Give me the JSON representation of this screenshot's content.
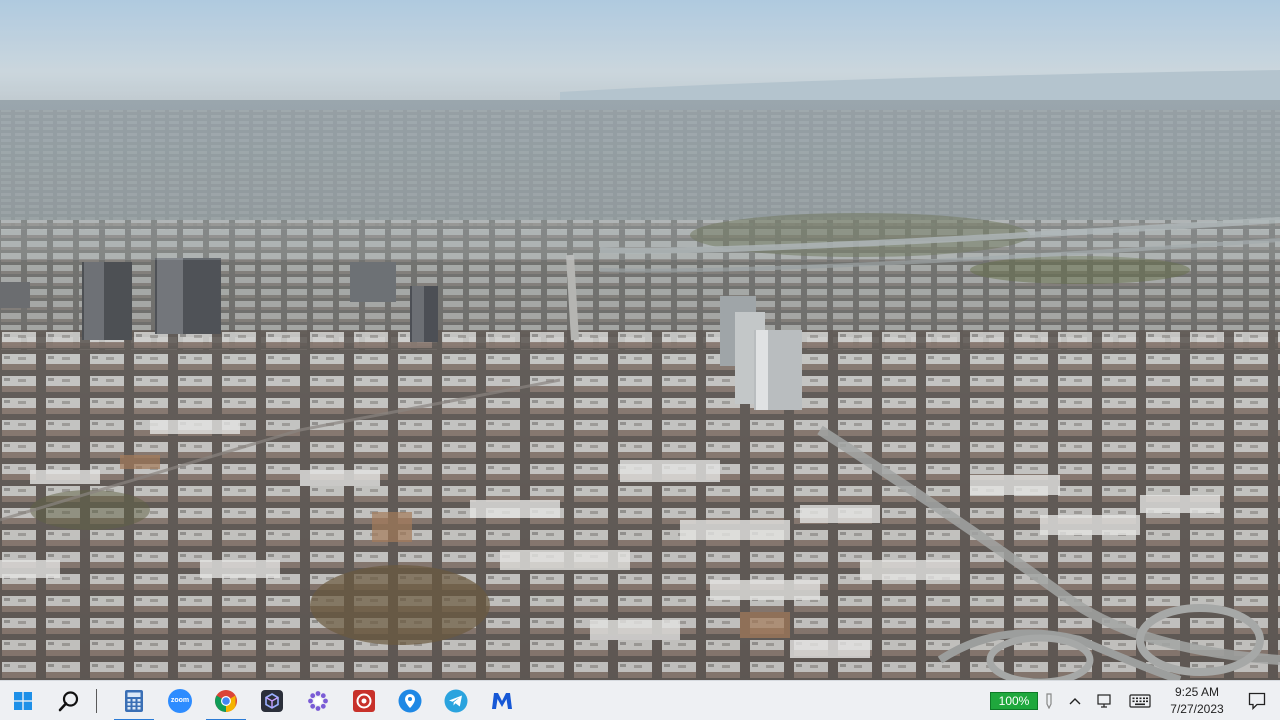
{
  "desktop": {
    "wallpaper": "aerial-city-photo"
  },
  "taskbar": {
    "start": {
      "icon": "windows-logo-icon"
    },
    "search": {
      "icon": "search-icon"
    },
    "apps": [
      {
        "name": "calculator",
        "icon": "calculator-icon",
        "color": "#3a6fb5",
        "running": true
      },
      {
        "name": "zoom",
        "icon": "zoom-icon",
        "color": "#2d8cff",
        "label": "zoom",
        "running": false
      },
      {
        "name": "chrome",
        "icon": "chrome-icon",
        "color": "#db4437",
        "running": true
      },
      {
        "name": "app-dark-cube",
        "icon": "cube-app-icon",
        "color": "#2b2f3a",
        "running": false
      },
      {
        "name": "app-gear",
        "icon": "gear-flower-icon",
        "color": "#7b5cd6",
        "running": false
      },
      {
        "name": "app-red-square",
        "icon": "red-square-app-icon",
        "color": "#c8312a",
        "running": false
      },
      {
        "name": "maps",
        "icon": "map-pin-icon",
        "color": "#1e88e5",
        "running": false
      },
      {
        "name": "telegram",
        "icon": "telegram-icon",
        "color": "#2aa3de",
        "running": false
      },
      {
        "name": "malwarebytes",
        "icon": "malwarebytes-icon",
        "color": "#1658d6",
        "running": false
      }
    ],
    "tray": {
      "battery_percent": "100%",
      "battery_color": "#1fa83d",
      "time": "9:25 AM",
      "date": "7/27/2023"
    }
  }
}
